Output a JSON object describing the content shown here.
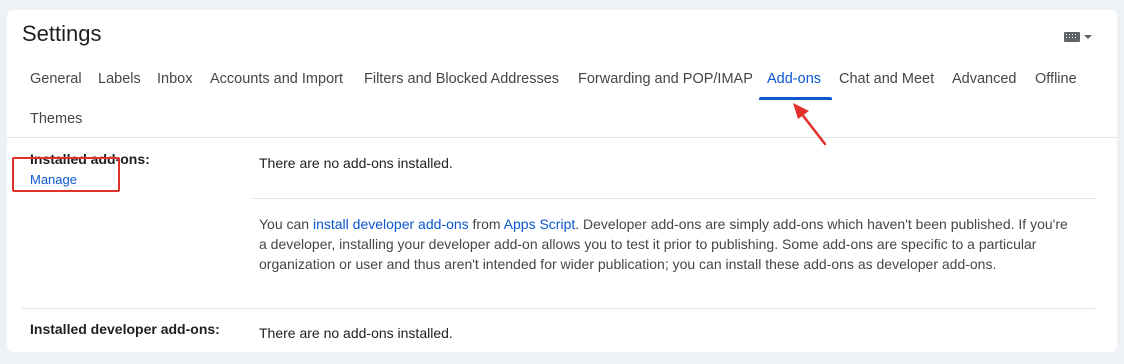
{
  "header": {
    "title": "Settings",
    "input_tool_icon": "keyboard-icon"
  },
  "tabs": [
    {
      "label": "General",
      "active": false
    },
    {
      "label": "Labels",
      "active": false
    },
    {
      "label": "Inbox",
      "active": false
    },
    {
      "label": "Accounts and Import",
      "active": false
    },
    {
      "label": "Filters and Blocked Addresses",
      "active": false
    },
    {
      "label": "Forwarding and POP/IMAP",
      "active": false
    },
    {
      "label": "Add-ons",
      "active": true
    },
    {
      "label": "Chat and Meet",
      "active": false
    },
    {
      "label": "Advanced",
      "active": false
    },
    {
      "label": "Offline",
      "active": false
    },
    {
      "label": "Themes",
      "active": false
    }
  ],
  "addons": {
    "installed_label": "Installed add-ons:",
    "manage_link": "Manage",
    "installed_value": "There are no add-ons installed.",
    "info": {
      "part1": "You can ",
      "link1": "install developer add-ons",
      "part2": " from ",
      "link2": "Apps Script",
      "part3": ". Developer add-ons are simply add-ons which haven't been published. If you're a developer, installing your developer add-on allows you to test it prior to publishing. Some add-ons are specific to a particular organization or user and thus aren't intended for wider publication; you can install these add-ons as developer add-ons."
    },
    "developer_label": "Installed developer add-ons:",
    "developer_value": "There are no add-ons installed."
  },
  "annotation": {
    "box_color": "#e2302a",
    "arrow_color": "#e2302a"
  },
  "colors": {
    "accent": "#0b57d0"
  }
}
